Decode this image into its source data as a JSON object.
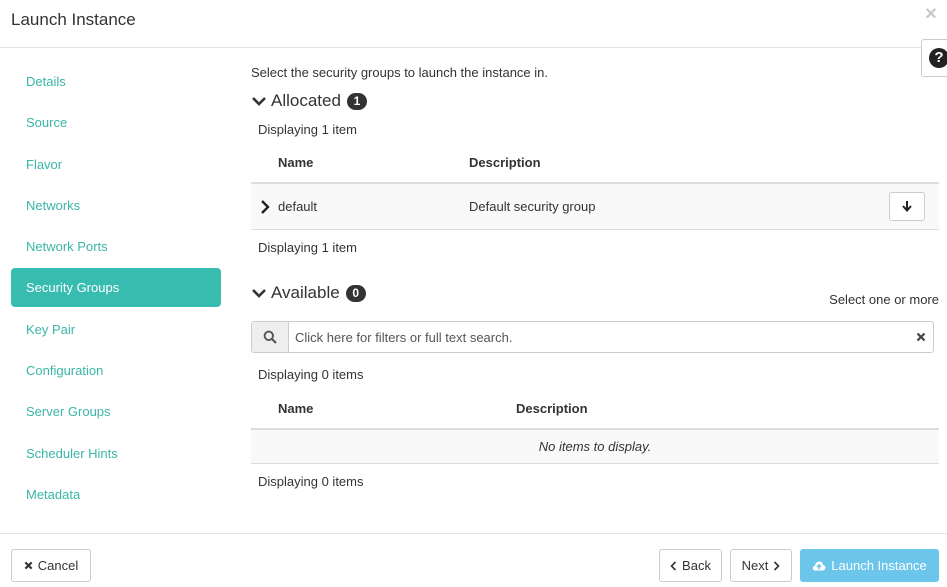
{
  "header": {
    "title": "Launch Instance",
    "close_label": "×",
    "help_label": "?"
  },
  "sidebar": {
    "items": [
      {
        "label": "Details"
      },
      {
        "label": "Source"
      },
      {
        "label": "Flavor"
      },
      {
        "label": "Networks"
      },
      {
        "label": "Network Ports"
      },
      {
        "label": "Security Groups",
        "active": true
      },
      {
        "label": "Key Pair"
      },
      {
        "label": "Configuration"
      },
      {
        "label": "Server Groups"
      },
      {
        "label": "Scheduler Hints"
      },
      {
        "label": "Metadata"
      }
    ]
  },
  "main": {
    "intro": "Select the security groups to launch the instance in.",
    "allocated": {
      "title": "Allocated",
      "badge": "1",
      "count_top": "Displaying 1 item",
      "count_bottom": "Displaying 1 item",
      "columns": [
        "Name",
        "Description"
      ],
      "rows": [
        {
          "name": "default",
          "description": "Default security group"
        }
      ]
    },
    "available": {
      "title": "Available",
      "badge": "0",
      "hint": "Select one or more",
      "search_placeholder": "Click here for filters or full text search.",
      "search_value": "",
      "count_top": "Displaying 0 items",
      "count_bottom": "Displaying 0 items",
      "columns": [
        "Name",
        "Description"
      ],
      "empty_text": "No items to display."
    }
  },
  "footer": {
    "cancel_label": "Cancel",
    "back_label": "Back",
    "next_label": "Next",
    "launch_label": "Launch Instance"
  },
  "colors": {
    "accent": "#38bcb0",
    "link": "#3ab5a8",
    "primary_button": "#6cc5ea"
  },
  "icons": {
    "close": "close-icon",
    "help": "question-circle-icon",
    "section_toggle": "chevron-down-icon",
    "row_expand": "chevron-right-icon",
    "deallocate": "arrow-down-icon",
    "search": "search-icon",
    "clear": "clear-icon",
    "cancel": "times-icon",
    "back": "chevron-left-icon",
    "next": "chevron-right-icon",
    "launch": "cloud-upload-icon"
  }
}
